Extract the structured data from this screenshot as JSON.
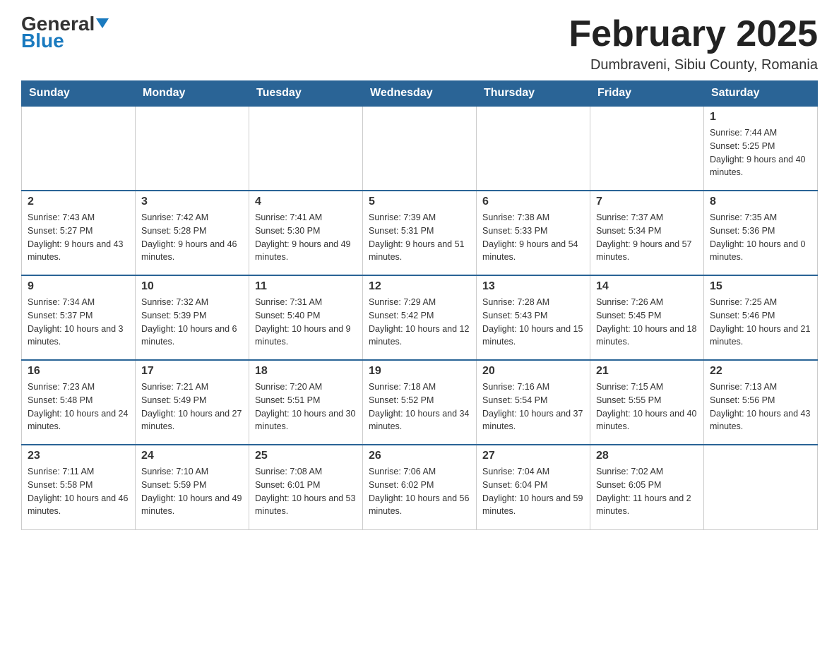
{
  "header": {
    "logo_general": "General",
    "logo_blue": "Blue",
    "title": "February 2025",
    "location": "Dumbraveni, Sibiu County, Romania"
  },
  "days_of_week": [
    "Sunday",
    "Monday",
    "Tuesday",
    "Wednesday",
    "Thursday",
    "Friday",
    "Saturday"
  ],
  "weeks": [
    {
      "days": [
        {
          "num": "",
          "info": ""
        },
        {
          "num": "",
          "info": ""
        },
        {
          "num": "",
          "info": ""
        },
        {
          "num": "",
          "info": ""
        },
        {
          "num": "",
          "info": ""
        },
        {
          "num": "",
          "info": ""
        },
        {
          "num": "1",
          "info": "Sunrise: 7:44 AM\nSunset: 5:25 PM\nDaylight: 9 hours and 40 minutes."
        }
      ]
    },
    {
      "days": [
        {
          "num": "2",
          "info": "Sunrise: 7:43 AM\nSunset: 5:27 PM\nDaylight: 9 hours and 43 minutes."
        },
        {
          "num": "3",
          "info": "Sunrise: 7:42 AM\nSunset: 5:28 PM\nDaylight: 9 hours and 46 minutes."
        },
        {
          "num": "4",
          "info": "Sunrise: 7:41 AM\nSunset: 5:30 PM\nDaylight: 9 hours and 49 minutes."
        },
        {
          "num": "5",
          "info": "Sunrise: 7:39 AM\nSunset: 5:31 PM\nDaylight: 9 hours and 51 minutes."
        },
        {
          "num": "6",
          "info": "Sunrise: 7:38 AM\nSunset: 5:33 PM\nDaylight: 9 hours and 54 minutes."
        },
        {
          "num": "7",
          "info": "Sunrise: 7:37 AM\nSunset: 5:34 PM\nDaylight: 9 hours and 57 minutes."
        },
        {
          "num": "8",
          "info": "Sunrise: 7:35 AM\nSunset: 5:36 PM\nDaylight: 10 hours and 0 minutes."
        }
      ]
    },
    {
      "days": [
        {
          "num": "9",
          "info": "Sunrise: 7:34 AM\nSunset: 5:37 PM\nDaylight: 10 hours and 3 minutes."
        },
        {
          "num": "10",
          "info": "Sunrise: 7:32 AM\nSunset: 5:39 PM\nDaylight: 10 hours and 6 minutes."
        },
        {
          "num": "11",
          "info": "Sunrise: 7:31 AM\nSunset: 5:40 PM\nDaylight: 10 hours and 9 minutes."
        },
        {
          "num": "12",
          "info": "Sunrise: 7:29 AM\nSunset: 5:42 PM\nDaylight: 10 hours and 12 minutes."
        },
        {
          "num": "13",
          "info": "Sunrise: 7:28 AM\nSunset: 5:43 PM\nDaylight: 10 hours and 15 minutes."
        },
        {
          "num": "14",
          "info": "Sunrise: 7:26 AM\nSunset: 5:45 PM\nDaylight: 10 hours and 18 minutes."
        },
        {
          "num": "15",
          "info": "Sunrise: 7:25 AM\nSunset: 5:46 PM\nDaylight: 10 hours and 21 minutes."
        }
      ]
    },
    {
      "days": [
        {
          "num": "16",
          "info": "Sunrise: 7:23 AM\nSunset: 5:48 PM\nDaylight: 10 hours and 24 minutes."
        },
        {
          "num": "17",
          "info": "Sunrise: 7:21 AM\nSunset: 5:49 PM\nDaylight: 10 hours and 27 minutes."
        },
        {
          "num": "18",
          "info": "Sunrise: 7:20 AM\nSunset: 5:51 PM\nDaylight: 10 hours and 30 minutes."
        },
        {
          "num": "19",
          "info": "Sunrise: 7:18 AM\nSunset: 5:52 PM\nDaylight: 10 hours and 34 minutes."
        },
        {
          "num": "20",
          "info": "Sunrise: 7:16 AM\nSunset: 5:54 PM\nDaylight: 10 hours and 37 minutes."
        },
        {
          "num": "21",
          "info": "Sunrise: 7:15 AM\nSunset: 5:55 PM\nDaylight: 10 hours and 40 minutes."
        },
        {
          "num": "22",
          "info": "Sunrise: 7:13 AM\nSunset: 5:56 PM\nDaylight: 10 hours and 43 minutes."
        }
      ]
    },
    {
      "days": [
        {
          "num": "23",
          "info": "Sunrise: 7:11 AM\nSunset: 5:58 PM\nDaylight: 10 hours and 46 minutes."
        },
        {
          "num": "24",
          "info": "Sunrise: 7:10 AM\nSunset: 5:59 PM\nDaylight: 10 hours and 49 minutes."
        },
        {
          "num": "25",
          "info": "Sunrise: 7:08 AM\nSunset: 6:01 PM\nDaylight: 10 hours and 53 minutes."
        },
        {
          "num": "26",
          "info": "Sunrise: 7:06 AM\nSunset: 6:02 PM\nDaylight: 10 hours and 56 minutes."
        },
        {
          "num": "27",
          "info": "Sunrise: 7:04 AM\nSunset: 6:04 PM\nDaylight: 10 hours and 59 minutes."
        },
        {
          "num": "28",
          "info": "Sunrise: 7:02 AM\nSunset: 6:05 PM\nDaylight: 11 hours and 2 minutes."
        },
        {
          "num": "",
          "info": ""
        }
      ]
    }
  ]
}
